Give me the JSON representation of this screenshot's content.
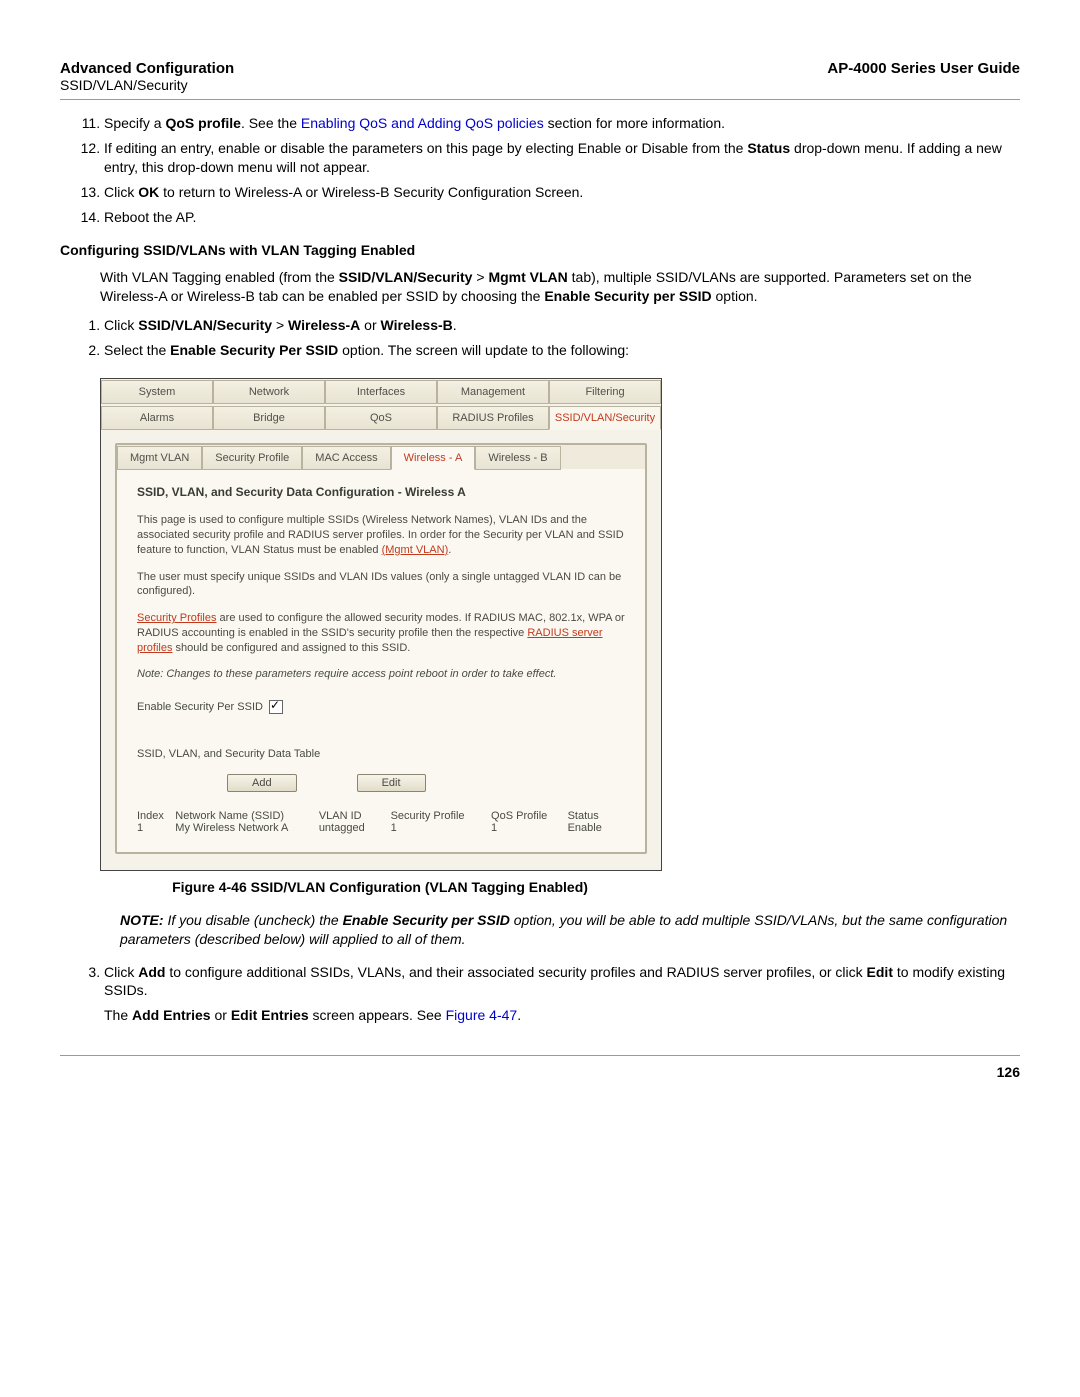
{
  "header": {
    "left": "Advanced Configuration",
    "right": "AP-4000 Series User Guide",
    "sub": "SSID/VLAN/Security"
  },
  "steps_top": {
    "start": 11,
    "s11_a": "Specify a ",
    "s11_b": "QoS profile",
    "s11_c": ". See the ",
    "s11_link": "Enabling QoS and Adding QoS policies",
    "s11_d": " section for more information.",
    "s12_a": "If editing an entry, enable or disable the parameters on this page by electing Enable or Disable from the ",
    "s12_b": "Status",
    "s12_c": " drop-down menu. If adding a new entry, this drop-down menu will not appear.",
    "s13_a": "Click ",
    "s13_b": "OK",
    "s13_c": " to return to Wireless-A or Wireless-B Security Configuration Screen.",
    "s14": "Reboot the AP."
  },
  "section_head": "Configuring SSID/VLANs with VLAN Tagging Enabled",
  "para1": {
    "a": "With VLAN Tagging enabled (from the ",
    "b": "SSID/VLAN/Security",
    "gt1": " > ",
    "c": "Mgmt VLAN",
    "d": " tab), multiple SSID/VLANs are supported. Parameters set on the Wireless-A or Wireless-B tab can be enabled per SSID by choosing the ",
    "e": "Enable Security per SSID",
    "f": " option."
  },
  "steps_mid": {
    "s1_a": "Click ",
    "s1_b": "SSID/VLAN/Security",
    "s1_gt": " > ",
    "s1_c": "Wireless-A",
    "s1_d": " or ",
    "s1_e": "Wireless-B",
    "s1_f": ".",
    "s2_a": "Select the ",
    "s2_b": "Enable Security Per SSID",
    "s2_c": " option. The screen will update to the following:"
  },
  "figure": {
    "tabs_row1": [
      "System",
      "Network",
      "Interfaces",
      "Management",
      "Filtering"
    ],
    "tabs_row2": [
      "Alarms",
      "Bridge",
      "QoS",
      "RADIUS Profiles",
      "SSID/VLAN/Security"
    ],
    "tabs_row2_active": 4,
    "subtabs": [
      "Mgmt VLAN",
      "Security Profile",
      "MAC Access",
      "Wireless - A",
      "Wireless - B"
    ],
    "subtabs_active": 3,
    "panel_title": "SSID, VLAN, and Security Data Configuration - Wireless A",
    "p1_a": "This page is used to configure multiple SSIDs (Wireless Network Names), VLAN IDs and the associated security profile and RADIUS server profiles. In order for the Security per VLAN and SSID feature to function, VLAN Status must be enabled ",
    "p1_link": "(Mgmt VLAN)",
    "p1_b": ".",
    "p2": "The user must specify unique SSIDs and VLAN IDs values (only a single untagged VLAN ID can be configured).",
    "p3_link1": "Security Profiles",
    "p3_a": " are used to configure the allowed security modes. If RADIUS MAC, 802.1x, WPA or RADIUS accounting is enabled in the SSID's security profile then the respective ",
    "p3_link2": "RADIUS server profiles",
    "p3_b": " should be configured and assigned to this SSID.",
    "note": "Note: Changes to these parameters require access point reboot in order to take effect.",
    "enable_label": "Enable Security Per SSID",
    "table_title": "SSID, VLAN, and Security Data Table",
    "btn_add": "Add",
    "btn_edit": "Edit",
    "th": [
      "Index",
      "Network Name (SSID)",
      "VLAN ID",
      "Security Profile",
      "QoS Profile",
      "Status"
    ],
    "row": [
      "1",
      "My Wireless Network A",
      "untagged",
      "1",
      "1",
      "Enable"
    ]
  },
  "caption": "Figure 4-46 SSID/VLAN Configuration (VLAN Tagging Enabled)",
  "note_block": {
    "label": "NOTE:",
    "a": " If you disable (uncheck) the ",
    "b": "Enable Security per SSID",
    "c": " option, you will be able to add multiple SSID/VLANs, but the same configuration parameters (described below) will applied to all of them."
  },
  "steps_bottom": {
    "s3_a": "Click ",
    "s3_b": "Add",
    "s3_c": " to configure additional SSIDs, VLANs, and their associated security profiles and RADIUS server profiles, or click ",
    "s3_d": "Edit",
    "s3_e": " to modify existing SSIDs.",
    "s3b_a": "The ",
    "s3b_b": "Add Entries",
    "s3b_c": " or ",
    "s3b_d": "Edit Entries",
    "s3b_e": " screen appears. See ",
    "s3b_link": "Figure 4-47",
    "s3b_f": "."
  },
  "page_num": "126"
}
